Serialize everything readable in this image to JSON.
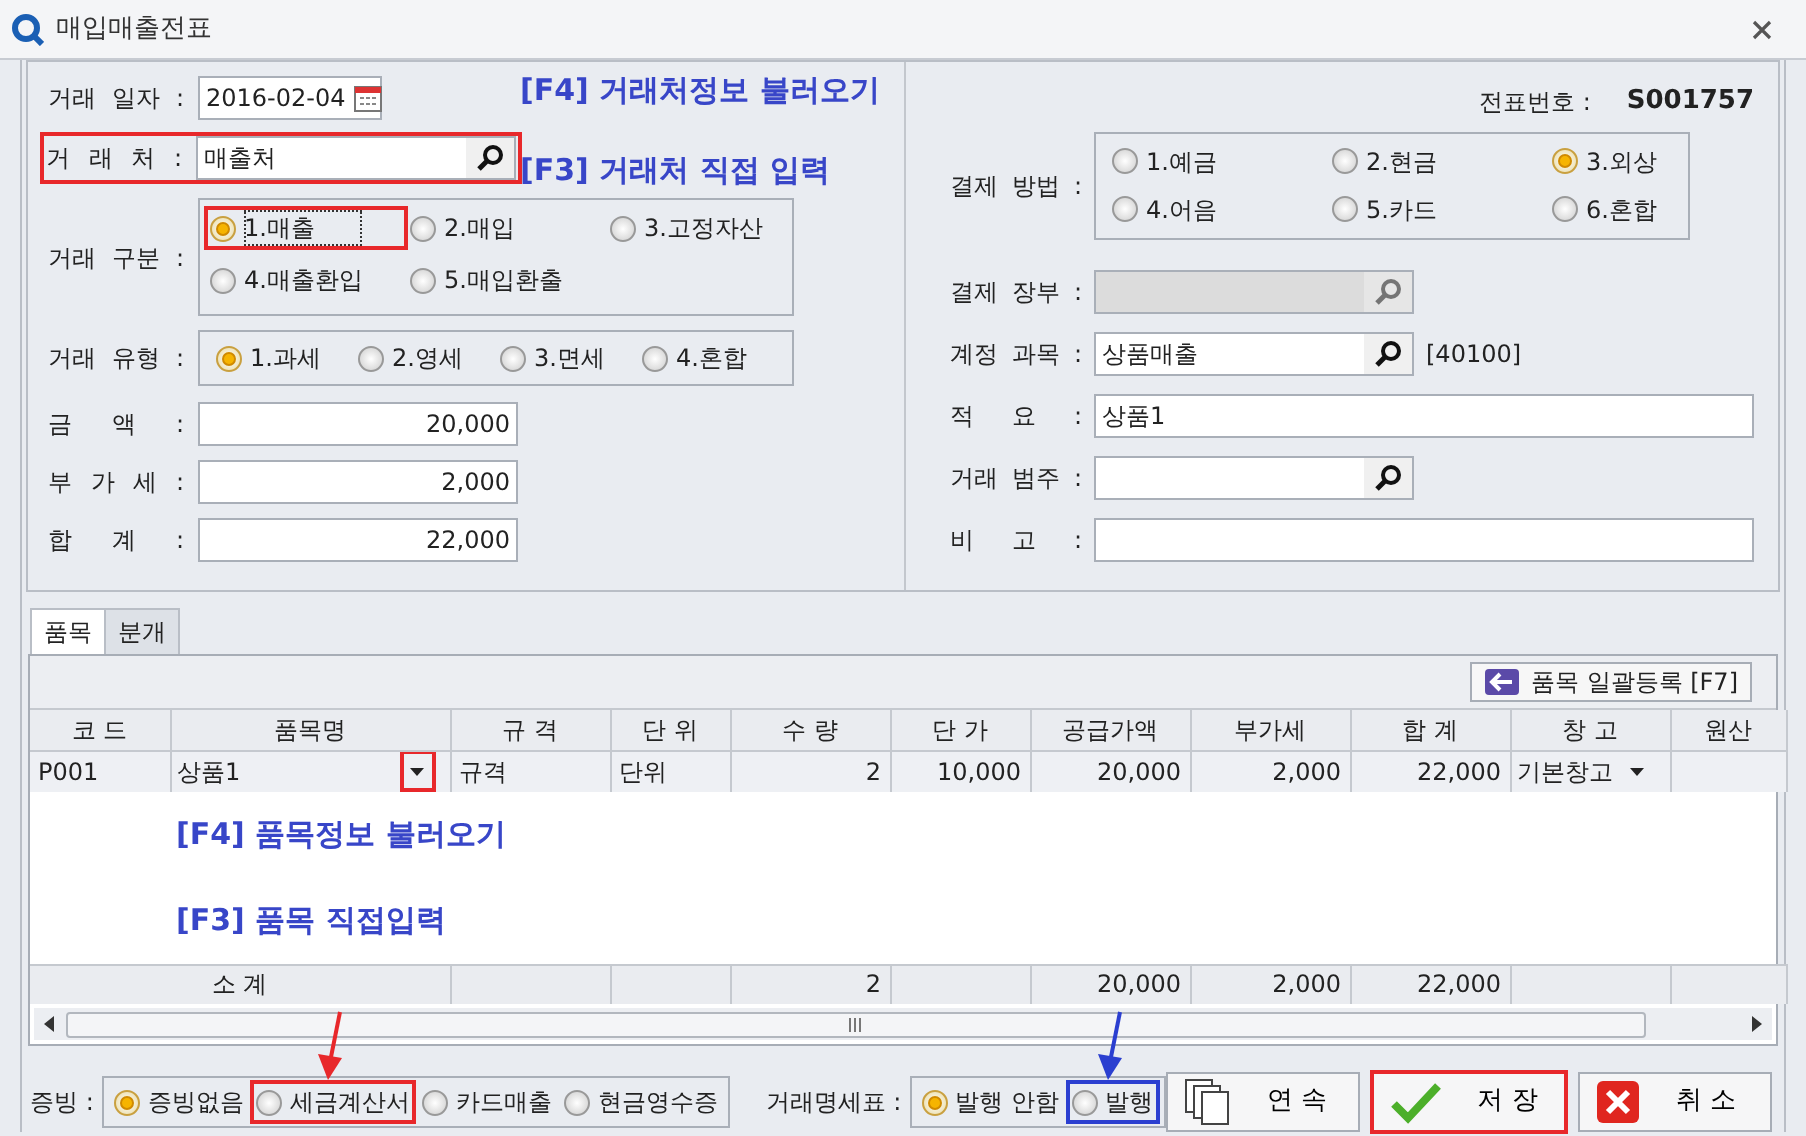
{
  "window": {
    "title": "매입매출전표"
  },
  "annotations": [
    {
      "text": "[F4] 거래처정보 불러오기"
    },
    {
      "text": "[F3] 거래처 직접 입력"
    }
  ],
  "left_form": {
    "date": {
      "label": "거래 일자 :",
      "value": "2016-02-04"
    },
    "client": {
      "label": "거 래 처 :",
      "value": "매출처",
      "color": "#e8282b"
    },
    "trade_class": {
      "label": "거래 구분 :",
      "options": [
        {
          "label": "1.매출",
          "selected": true,
          "focused": true,
          "color": "#e8282b"
        },
        {
          "label": "2.매입",
          "selected": false,
          "focused": false
        },
        {
          "label": "3.고정자산",
          "selected": false,
          "focused": false
        },
        {
          "label": "4.매출환입",
          "selected": false,
          "focused": false
        },
        {
          "label": "5.매입환출",
          "selected": false,
          "focused": false
        }
      ]
    },
    "trade_type": {
      "label": "거래 유형 :",
      "options": [
        {
          "label": "1.과세",
          "selected": true
        },
        {
          "label": "2.영세",
          "selected": false
        },
        {
          "label": "3.면세",
          "selected": false
        },
        {
          "label": "4.혼합",
          "selected": false
        }
      ]
    },
    "amounts": [
      {
        "label": "금 액 :",
        "value": "20,000"
      },
      {
        "label": "부 가 세 :",
        "value": "2,000"
      },
      {
        "label": "합 계 :",
        "value": "22,000"
      }
    ]
  },
  "right_form": {
    "voucher_no": {
      "label": "전표번호 :",
      "value": "S001757"
    },
    "payment_method": {
      "label": "결제 방법 :",
      "options": [
        {
          "label": "1.예금",
          "selected": false
        },
        {
          "label": "2.현금",
          "selected": false
        },
        {
          "label": "3.외상",
          "selected": true
        },
        {
          "label": "4.어음",
          "selected": false
        },
        {
          "label": "5.카드",
          "selected": false
        },
        {
          "label": "6.혼합",
          "selected": false
        }
      ]
    },
    "fields": [
      {
        "label": "결제 장부 :",
        "kind": "search",
        "disabled": true
      },
      {
        "label": "계정 과목 :",
        "kind": "search",
        "disabled": false,
        "value": "상품매출",
        "code": "[40100]"
      },
      {
        "label": "적 요 :",
        "kind": "text",
        "disabled": false,
        "value": "상품1"
      },
      {
        "label": "거래 범주 :",
        "kind": "search",
        "disabled": false
      },
      {
        "label": "비 고 :",
        "kind": "text",
        "disabled": false
      }
    ]
  },
  "tabs": [
    {
      "label": "품목",
      "selected": true
    },
    {
      "label": "분개",
      "selected": false
    }
  ],
  "grid": {
    "bulk_button": "품목 일괄등록 [F7]",
    "columns": [
      {
        "label": "코 드",
        "kind": "text"
      },
      {
        "label": "품목명",
        "kind": "text"
      },
      {
        "label": "규 격",
        "kind": "text"
      },
      {
        "label": "단 위",
        "kind": "text"
      },
      {
        "label": "수 량",
        "kind": "number"
      },
      {
        "label": "단 가",
        "kind": "number"
      },
      {
        "label": "공급가액",
        "kind": "number"
      },
      {
        "label": "부가세",
        "kind": "number"
      },
      {
        "label": "합 계",
        "kind": "number"
      },
      {
        "label": "창 고",
        "kind": "text"
      },
      {
        "label": "원산",
        "kind": "text"
      }
    ],
    "rows": [
      {
        "cells": [
          {
            "text": "P001"
          },
          {
            "text": "상품1",
            "dropdown": true,
            "color": "#e8282b"
          },
          {
            "text": "규격"
          },
          {
            "text": "단위"
          },
          {
            "text": "2"
          },
          {
            "text": "10,000"
          },
          {
            "text": "20,000"
          },
          {
            "text": "2,000"
          },
          {
            "text": "22,000"
          },
          {
            "text": "기본창고",
            "dropdown": true
          }
        ]
      }
    ],
    "annotations": [
      {
        "text": "[F4] 품목정보 불러오기"
      },
      {
        "text": "[F3] 품목 직접입력"
      }
    ],
    "subtotal": {
      "label": "소 계",
      "quantity": "2",
      "supply": "20,000",
      "vat": "2,000",
      "total": "22,000"
    }
  },
  "footer": {
    "evidence": {
      "label": "증빙 :",
      "options": [
        {
          "label": "증빙없음",
          "selected": true
        },
        {
          "label": "세금계산서",
          "selected": false,
          "color": "#e8282b",
          "arrow": true
        },
        {
          "label": "카드매출",
          "selected": false
        },
        {
          "label": "현금영수증",
          "selected": false
        }
      ]
    },
    "statement": {
      "label": "거래명세표 :",
      "options": [
        {
          "label": "발행 안함",
          "selected": true
        },
        {
          "label": "발행",
          "selected": false,
          "color": "#2b3fd0",
          "arrow": true
        }
      ]
    },
    "buttons": [
      {
        "label": "연 속",
        "kind": "continue"
      },
      {
        "label": "저 장",
        "kind": "save",
        "color": "#e8282b"
      },
      {
        "label": "취 소",
        "kind": "cancel"
      }
    ]
  }
}
